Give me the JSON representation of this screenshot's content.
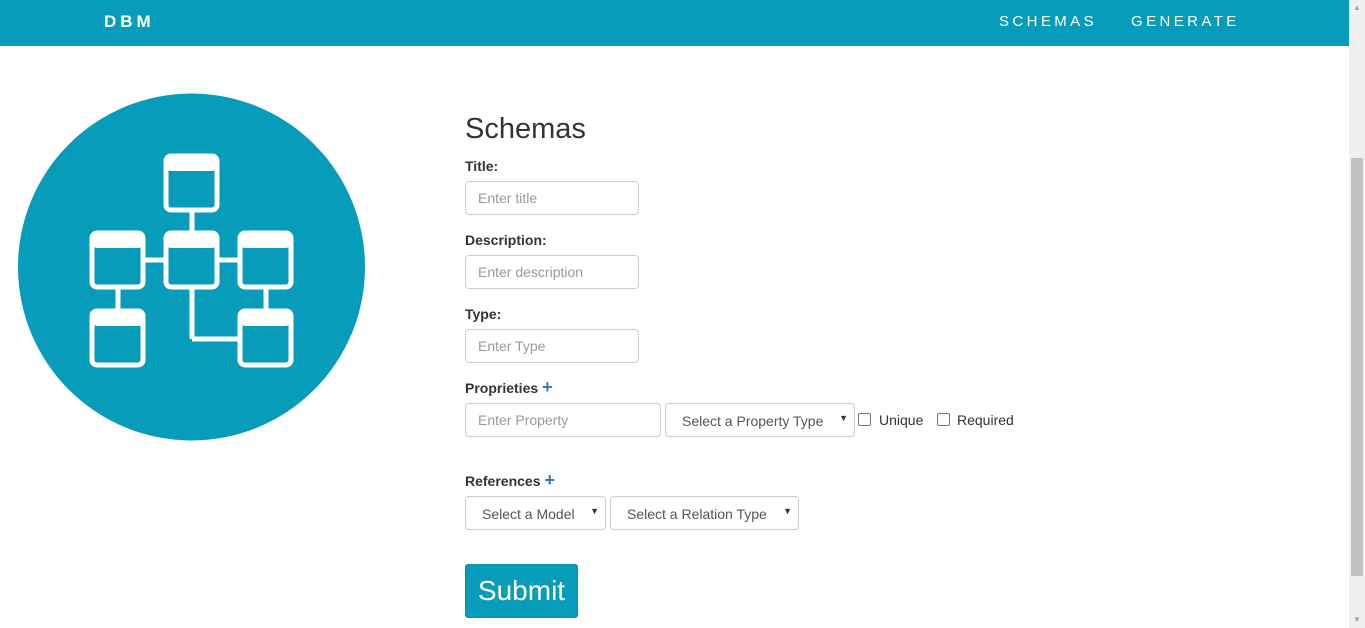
{
  "navbar": {
    "brand": "DBM",
    "links": [
      "SCHEMAS",
      "GENERATE"
    ],
    "color": "#079cb9"
  },
  "logo": {
    "icon": "database-schema-icon",
    "color": "#079cb9"
  },
  "form": {
    "heading": "Schemas",
    "title": {
      "label": "Title:",
      "placeholder": "Enter title"
    },
    "description": {
      "label": "Description:",
      "placeholder": "Enter description"
    },
    "type": {
      "label": "Type:",
      "placeholder": "Enter Type"
    },
    "properties": {
      "label": "Proprieties",
      "add_icon": "+",
      "property_placeholder": "Enter Property",
      "property_type_select": "Select a Property Type",
      "unique_label": "Unique",
      "required_label": "Required"
    },
    "references": {
      "label": "References",
      "add_icon": "+",
      "model_select": "Select a Model",
      "relation_select": "Select a Relation Type"
    },
    "submit_label": "Submit"
  }
}
